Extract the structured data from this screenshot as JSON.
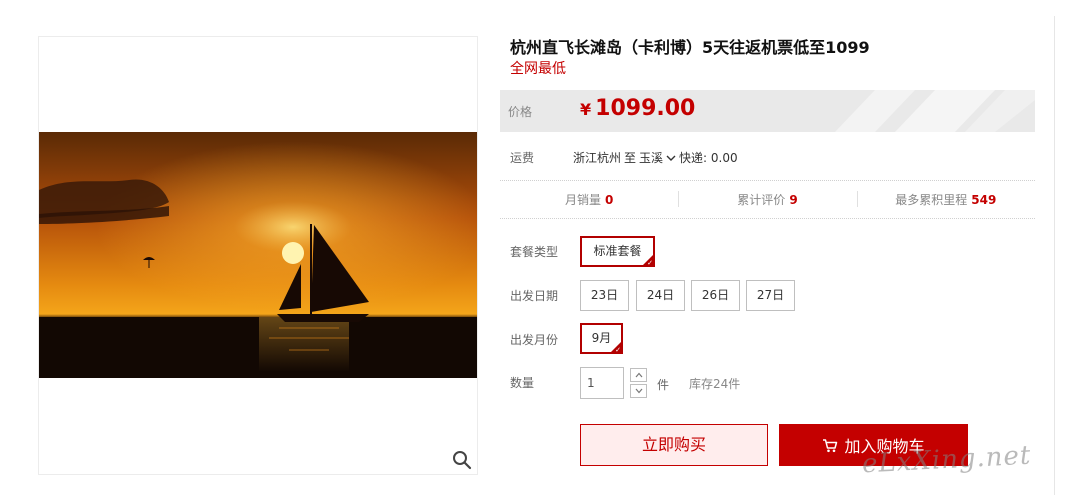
{
  "product": {
    "title": "杭州直飞长滩岛（卡利博）5天往返机票低至1099",
    "subtitle": "全网最低"
  },
  "price": {
    "label": "价格",
    "currency": "¥",
    "value": "1099.00"
  },
  "shipping": {
    "label": "运费",
    "origin": "浙江杭州",
    "to": "至",
    "destination": "玉溪",
    "method": "快递: 0.00"
  },
  "stats": [
    {
      "label": "月销量",
      "value": "0"
    },
    {
      "label": "累计评价",
      "value": "9"
    },
    {
      "label": "最多累积里程",
      "value": "549"
    }
  ],
  "package": {
    "label": "套餐类型",
    "options": [
      {
        "label": "标准套餐",
        "selected": true
      }
    ]
  },
  "departure_date": {
    "label": "出发日期",
    "options": [
      {
        "label": "23日",
        "selected": false
      },
      {
        "label": "24日",
        "selected": false
      },
      {
        "label": "26日",
        "selected": false
      },
      {
        "label": "27日",
        "selected": false
      }
    ]
  },
  "departure_month": {
    "label": "出发月份",
    "options": [
      {
        "label": "9月",
        "selected": true
      }
    ]
  },
  "quantity": {
    "label": "数量",
    "value": "1",
    "unit": "件",
    "stock": "库存24件"
  },
  "actions": {
    "buy_now": "立即购买",
    "add_to_cart": "加入购物车"
  },
  "icons": {
    "zoom": "magnifier-icon",
    "cart": "cart-icon",
    "dropdown": "chevron-down-icon"
  },
  "colors": {
    "accent": "#c40000",
    "selected_border": "#b20000",
    "price_band": "#e9e9e9"
  },
  "watermark": "eLxXing.net"
}
